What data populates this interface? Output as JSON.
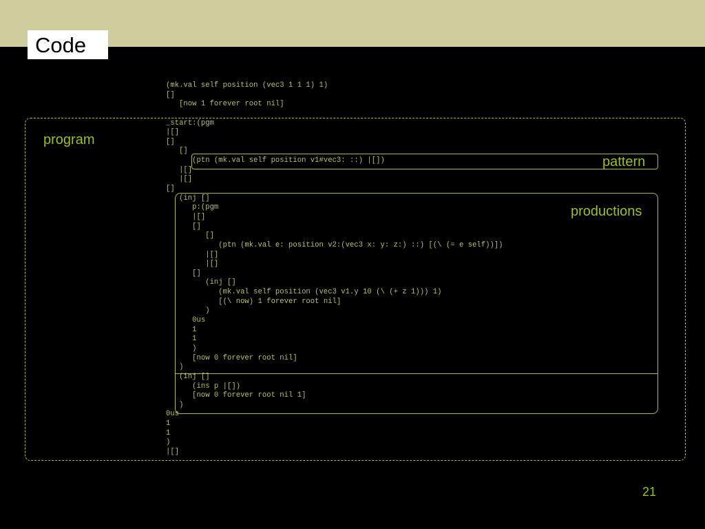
{
  "slide": {
    "title": "Code",
    "page_number": "21",
    "accent_color": "#9bc21f",
    "frame_color": "#b5bd3a",
    "header_color": "#cfcc9e"
  },
  "labels": {
    "program": "program",
    "pattern": "pattern",
    "productions": "productions"
  },
  "code_lines": [
    "(mk.val self position (vec3 1 1 1) 1)",
    "[]",
    "   [now 1 forever root nil]",
    "",
    "_start:(pgm",
    "|[]",
    "[]",
    "   []",
    "      (ptn (mk.val self position v1#vec3: ::) |[])",
    "   |[]",
    "   |[]",
    "[]",
    "   (inj []",
    "      p:(pgm",
    "      |[]",
    "      []",
    "         []",
    "            (ptn (mk.val e: position v2:(vec3 x: y: z:) ::) [(\\ (= e self))])",
    "         |[]",
    "         |[]",
    "      []",
    "         (inj []",
    "            (mk.val self position (vec3 v1.y 10 (\\ (+ z 1))) 1)",
    "            [(\\ now) 1 forever root nil]",
    "         )",
    "      0us",
    "      1",
    "      1",
    "      )",
    "      [now 0 forever root nil]",
    "   )",
    "   (inj []",
    "      (ins p |[])",
    "      [now 0 forever root nil 1]",
    "   )",
    "0us",
    "1",
    "1",
    ")",
    "|[]"
  ]
}
